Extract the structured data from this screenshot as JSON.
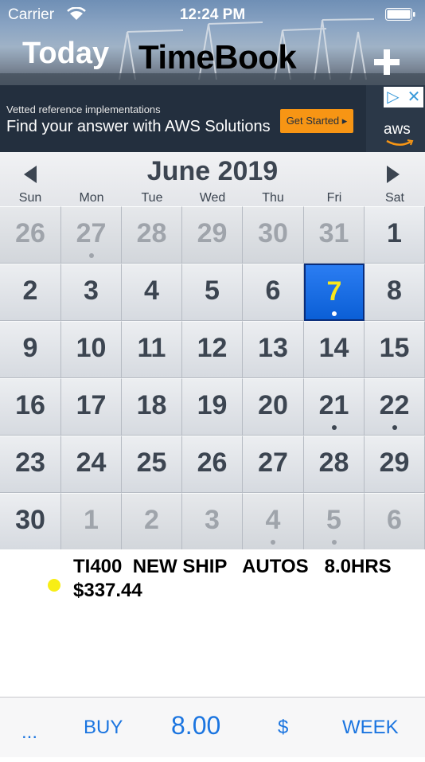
{
  "status_bar": {
    "carrier": "Carrier",
    "time": "12:24 PM"
  },
  "header": {
    "today_label": "Today",
    "title": "TimeBook",
    "add_icon": "plus-icon"
  },
  "ad": {
    "small_text": "Vetted reference implementations",
    "main_text": "Find your answer with AWS Solutions",
    "cta_label": "Get Started ▸",
    "brand": "aws",
    "adchoices_icon": "adchoices-icon",
    "close_icon": "close-icon"
  },
  "calendar": {
    "month_title": "June 2019",
    "weekdays": [
      "Sun",
      "Mon",
      "Tue",
      "Wed",
      "Thu",
      "Fri",
      "Sat"
    ],
    "selected_day": "7",
    "selected_color": "#1b6ee6",
    "weeks": [
      [
        {
          "d": "26",
          "o": true,
          "dot": false
        },
        {
          "d": "27",
          "o": true,
          "dot": true
        },
        {
          "d": "28",
          "o": true,
          "dot": false
        },
        {
          "d": "29",
          "o": true,
          "dot": false
        },
        {
          "d": "30",
          "o": true,
          "dot": false
        },
        {
          "d": "31",
          "o": true,
          "dot": false
        },
        {
          "d": "1",
          "o": false,
          "dot": false
        }
      ],
      [
        {
          "d": "2",
          "o": false,
          "dot": false
        },
        {
          "d": "3",
          "o": false,
          "dot": false
        },
        {
          "d": "4",
          "o": false,
          "dot": false
        },
        {
          "d": "5",
          "o": false,
          "dot": false
        },
        {
          "d": "6",
          "o": false,
          "dot": false
        },
        {
          "d": "7",
          "o": false,
          "dot": true,
          "sel": true
        },
        {
          "d": "8",
          "o": false,
          "dot": false
        }
      ],
      [
        {
          "d": "9",
          "o": false,
          "dot": false
        },
        {
          "d": "10",
          "o": false,
          "dot": false
        },
        {
          "d": "11",
          "o": false,
          "dot": false
        },
        {
          "d": "12",
          "o": false,
          "dot": false
        },
        {
          "d": "13",
          "o": false,
          "dot": false
        },
        {
          "d": "14",
          "o": false,
          "dot": false
        },
        {
          "d": "15",
          "o": false,
          "dot": false
        }
      ],
      [
        {
          "d": "16",
          "o": false,
          "dot": false
        },
        {
          "d": "17",
          "o": false,
          "dot": false
        },
        {
          "d": "18",
          "o": false,
          "dot": false
        },
        {
          "d": "19",
          "o": false,
          "dot": false
        },
        {
          "d": "20",
          "o": false,
          "dot": false
        },
        {
          "d": "21",
          "o": false,
          "dot": true
        },
        {
          "d": "22",
          "o": false,
          "dot": true
        }
      ],
      [
        {
          "d": "23",
          "o": false,
          "dot": false
        },
        {
          "d": "24",
          "o": false,
          "dot": false
        },
        {
          "d": "25",
          "o": false,
          "dot": false
        },
        {
          "d": "26",
          "o": false,
          "dot": false
        },
        {
          "d": "27",
          "o": false,
          "dot": false
        },
        {
          "d": "28",
          "o": false,
          "dot": false
        },
        {
          "d": "29",
          "o": false,
          "dot": false
        }
      ],
      [
        {
          "d": "30",
          "o": false,
          "dot": false
        },
        {
          "d": "1",
          "o": true,
          "dot": false
        },
        {
          "d": "2",
          "o": true,
          "dot": false
        },
        {
          "d": "3",
          "o": true,
          "dot": false
        },
        {
          "d": "4",
          "o": true,
          "dot": true
        },
        {
          "d": "5",
          "o": true,
          "dot": true
        },
        {
          "d": "6",
          "o": true,
          "dot": false
        }
      ]
    ]
  },
  "entry": {
    "line1": "TI400  NEW SHIP   AUTOS   8.0HRS",
    "line2": "$337.44",
    "dot_color": "#f8ee15"
  },
  "toolbar": {
    "more": "...",
    "buy": "BUY",
    "hours": "8.00",
    "dollar": "$",
    "week": "WEEK",
    "accent": "#1b75e0"
  }
}
